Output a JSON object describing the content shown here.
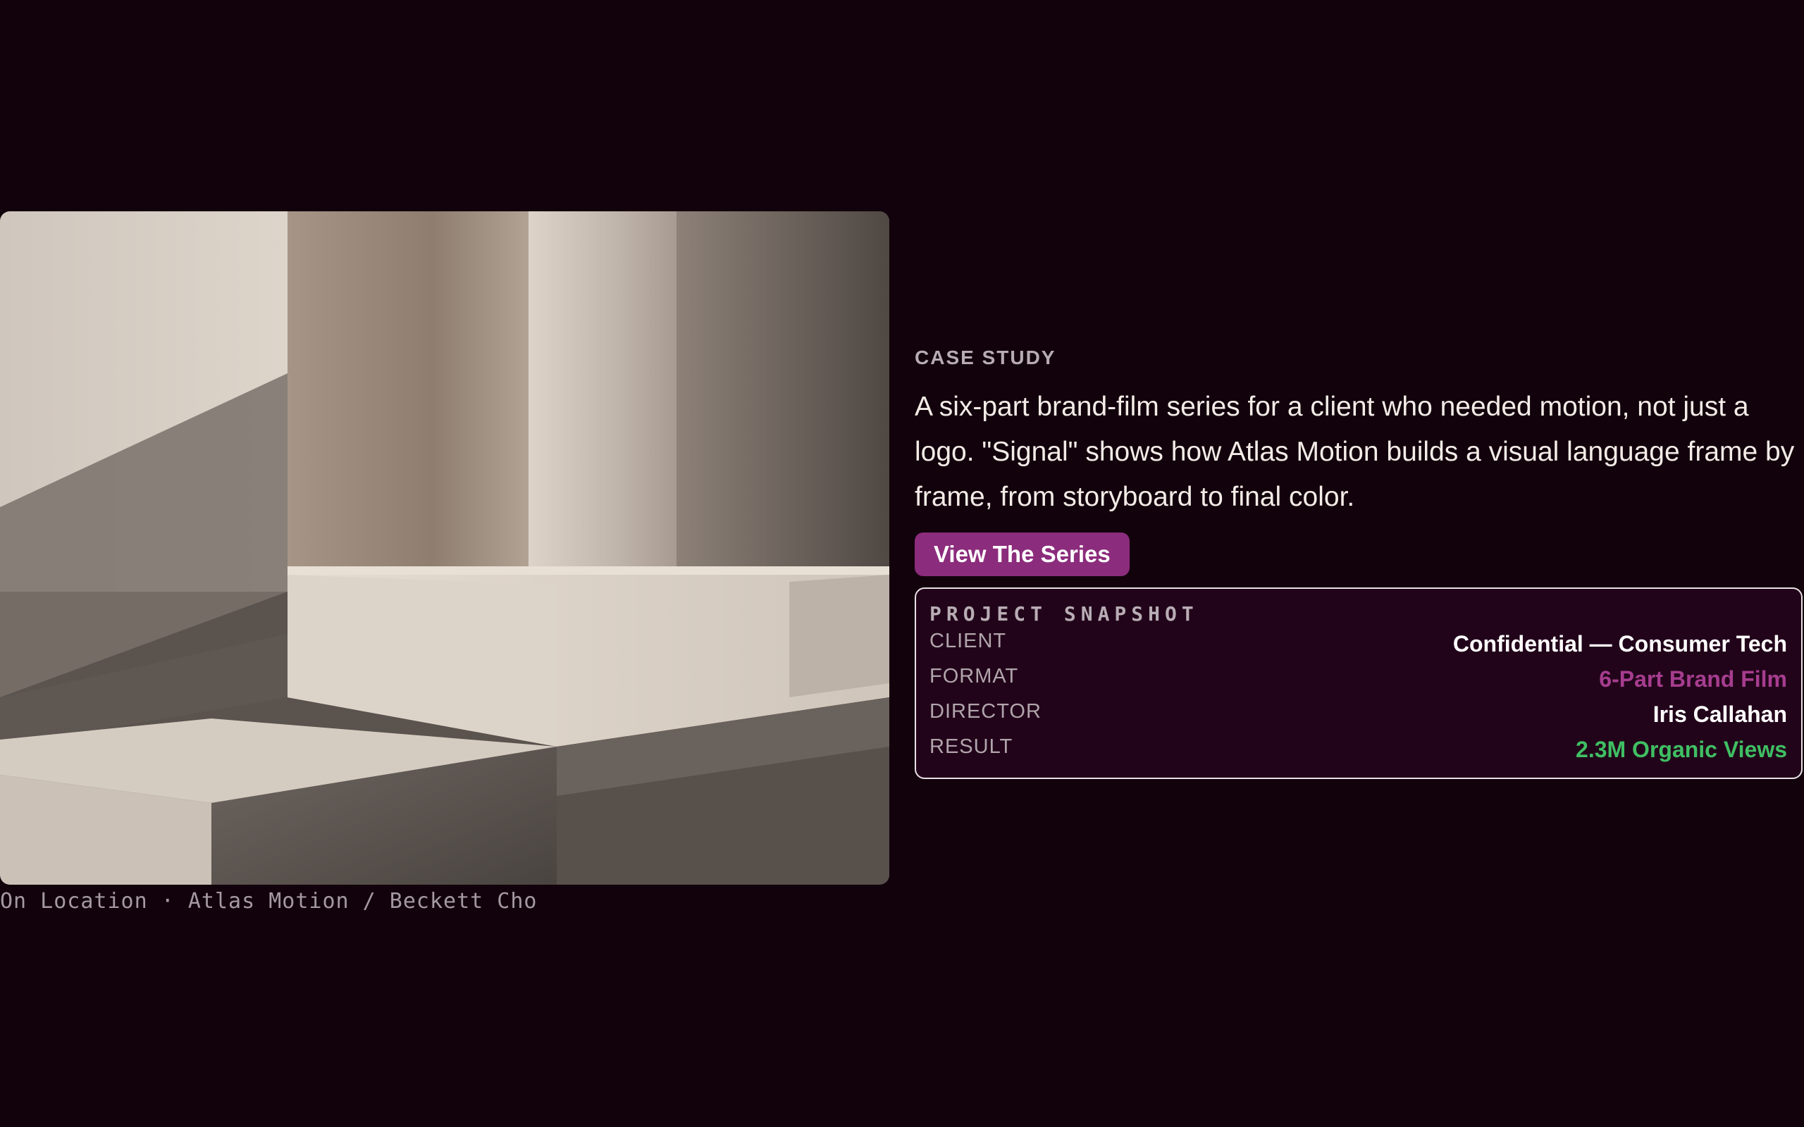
{
  "case_study": {
    "eyebrow": "CASE STUDY",
    "description": "A six-part brand-film series for a client who needed motion, not just a logo. \"Signal\" shows how Atlas Motion builds a visual language frame by frame, from storyboard to final color.",
    "cta_label": "View The Series"
  },
  "image": {
    "caption": "On Location · Atlas Motion / Beckett Cho"
  },
  "snapshot": {
    "title": "PROJECT SNAPSHOT",
    "rows": [
      {
        "label": "CLIENT",
        "value": "Confidential — Consumer Tech",
        "color": "#ffffff"
      },
      {
        "label": "FORMAT",
        "value": "6-Part Brand Film",
        "color": "#a63d8f"
      },
      {
        "label": "DIRECTOR",
        "value": "Iris Callahan",
        "color": "#ffffff"
      },
      {
        "label": "RESULT",
        "value": "2.3M Organic Views",
        "color": "#3fbf63"
      }
    ]
  },
  "colors": {
    "background": "#12020c",
    "accent": "#8c2c7c",
    "panel": "#22041a"
  }
}
